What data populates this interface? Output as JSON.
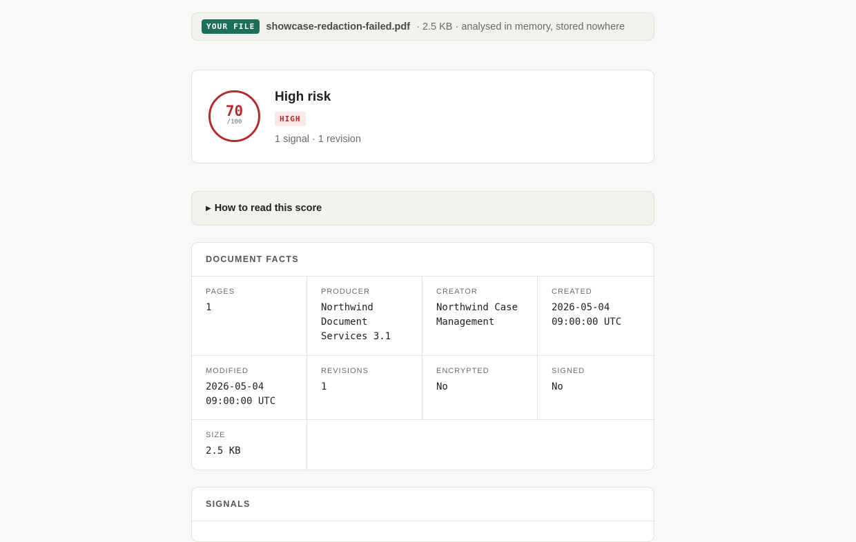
{
  "file_bar": {
    "tag": "YOUR FILE",
    "filename": "showcase-redaction-failed.pdf",
    "details": "· 2.5 KB · analysed in memory, stored nowhere"
  },
  "score": {
    "value": "70",
    "denominator": "/100",
    "title": "High risk",
    "badge": "HIGH",
    "meta": "1 signal · 1 revision",
    "accent_color": "#b42b2b"
  },
  "how_to_read": {
    "label": "How to read this score",
    "icon": "caret-right-icon"
  },
  "document_facts": {
    "title": "DOCUMENT FACTS",
    "items": [
      {
        "label": "PAGES",
        "value": "1"
      },
      {
        "label": "PRODUCER",
        "value": "Northwind Document Services 3.1"
      },
      {
        "label": "CREATOR",
        "value": "Northwind Case Management"
      },
      {
        "label": "CREATED",
        "value": "2026-05-04 09:00:00 UTC"
      },
      {
        "label": "MODIFIED",
        "value": "2026-05-04 09:00:00 UTC"
      },
      {
        "label": "REVISIONS",
        "value": "1"
      },
      {
        "label": "ENCRYPTED",
        "value": "No"
      },
      {
        "label": "SIGNED",
        "value": "No"
      },
      {
        "label": "SIZE",
        "value": "2.5 KB"
      }
    ]
  },
  "signals": {
    "title": "SIGNALS"
  },
  "colors": {
    "brand_tag": "#1e6e5c",
    "risk_high": "#b42b2b",
    "background": "#f9f8f6"
  }
}
